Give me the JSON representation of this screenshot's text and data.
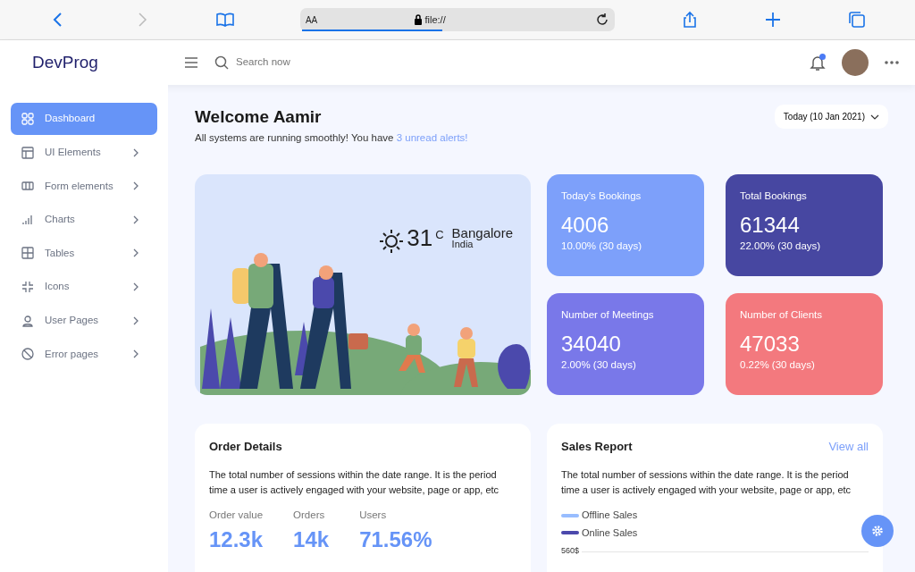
{
  "browser": {
    "text_size": "AA",
    "address": "file://"
  },
  "app": {
    "logo": "DevProg",
    "search": {
      "placeholder": "Search now"
    },
    "notification_unread": true
  },
  "sidebar": {
    "items": [
      {
        "label": "Dashboard",
        "selected": true,
        "expandable": false
      },
      {
        "label": "UI Elements",
        "selected": false,
        "expandable": true
      },
      {
        "label": "Form elements",
        "selected": false,
        "expandable": true
      },
      {
        "label": "Charts",
        "selected": false,
        "expandable": true
      },
      {
        "label": "Tables",
        "selected": false,
        "expandable": true
      },
      {
        "label": "Icons",
        "selected": false,
        "expandable": true
      },
      {
        "label": "User Pages",
        "selected": false,
        "expandable": true
      },
      {
        "label": "Error pages",
        "selected": false,
        "expandable": true
      }
    ]
  },
  "welcome": {
    "title": "Welcome Aamir",
    "message": "All systems are running smoothly! You have ",
    "alerts_link": "3 unread alerts!",
    "date_button": "Today (10 Jan 2021)"
  },
  "weather": {
    "temperature": "31",
    "unit": "C",
    "city": "Bangalore",
    "country": "India"
  },
  "stats": [
    {
      "title": "Today’s Bookings",
      "value": "4006",
      "change": "10.00% (30 days)",
      "color": "#7da0fa"
    },
    {
      "title": "Total Bookings",
      "value": "61344",
      "change": "22.00% (30 days)",
      "color": "#4747a1"
    },
    {
      "title": "Number of Meetings",
      "value": "34040",
      "change": "2.00% (30 days)",
      "color": "#7978e9"
    },
    {
      "title": "Number of Clients",
      "value": "47033",
      "change": "0.22% (30 days)",
      "color": "#f3797e"
    }
  ],
  "order_details": {
    "title": "Order Details",
    "description": "The total number of sessions within the date range. It is the period time a user is actively engaged with your website, page or app, etc",
    "metrics": [
      {
        "label": "Order value",
        "value": "12.3k"
      },
      {
        "label": "Orders",
        "value": "14k"
      },
      {
        "label": "Users",
        "value": "71.56%"
      }
    ]
  },
  "sales_report": {
    "title": "Sales Report",
    "link": "View all",
    "description": "The total number of sessions within the date range. It is the period time a user is actively engaged with your website, page or app, etc",
    "legend": [
      {
        "label": "Offline Sales",
        "color": "#98bdff"
      },
      {
        "label": "Online Sales",
        "color": "#4b49ac"
      }
    ],
    "axis_label": "560$"
  }
}
